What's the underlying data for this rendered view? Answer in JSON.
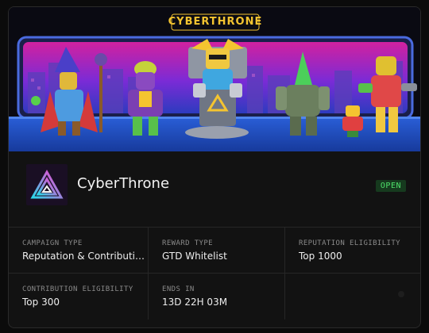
{
  "banner": {
    "title": "CYBERTHRONE"
  },
  "project": {
    "name": "CyberThrone",
    "status": "OPEN"
  },
  "info": {
    "campaign_type": {
      "label": "CAMPAIGN TYPE",
      "value": "Reputation & Contribution"
    },
    "reward_type": {
      "label": "REWARD TYPE",
      "value": "GTD Whitelist"
    },
    "reputation_eligibility": {
      "label": "REPUTATION ELIGIBILITY",
      "value": "Top 1000"
    },
    "contribution_eligibility": {
      "label": "CONTRIBUTION ELIGIBILITY",
      "value": "Top 300"
    },
    "ends_in": {
      "label": "ENDS IN",
      "value": "13D 22H 03M"
    }
  },
  "colors": {
    "accent_gold": "#f4c430",
    "status_green": "#4ee06a",
    "background": "#121212"
  }
}
